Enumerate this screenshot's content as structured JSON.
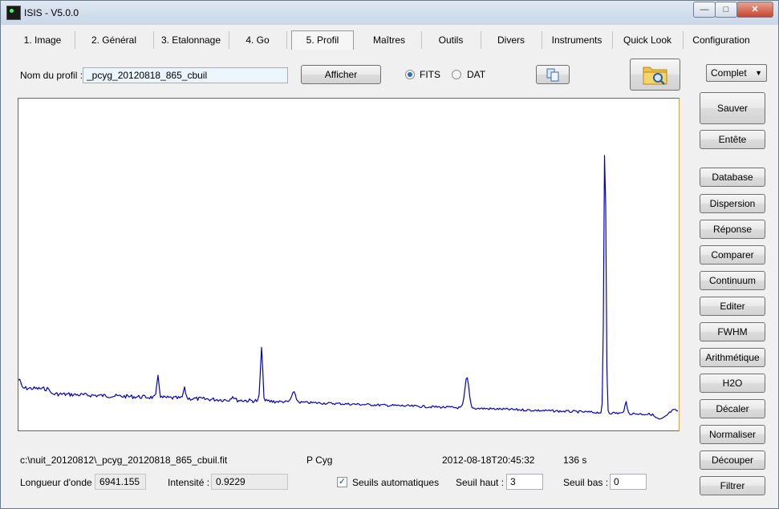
{
  "window": {
    "title": "ISIS - V5.0.0"
  },
  "controls": {
    "minimize": "—",
    "restore": "□",
    "close": "✕"
  },
  "tabs": [
    {
      "label": "1. Image"
    },
    {
      "label": "2. Général"
    },
    {
      "label": "3. Etalonnage"
    },
    {
      "label": "4. Go"
    },
    {
      "label": "5. Profil",
      "active": true
    },
    {
      "label": "Maîtres"
    },
    {
      "label": "Outils"
    },
    {
      "label": "Divers"
    },
    {
      "label": "Instruments"
    },
    {
      "label": "Quick Look"
    },
    {
      "label": "Configuration"
    }
  ],
  "profile": {
    "name_label": "Nom du profil :",
    "name_value": "_pcyg_20120818_865_cbuil",
    "show_button": "Afficher",
    "format_fits": "FITS",
    "format_dat": "DAT",
    "format_selected": "FITS"
  },
  "mode_select": {
    "value": "Complet"
  },
  "side_buttons": [
    "Sauver",
    "Entête",
    "Database",
    "Dispersion",
    "Réponse",
    "Comparer",
    "Continuum",
    "Editer",
    "FWHM",
    "Arithmétique",
    "H2O",
    "Décaler",
    "Normaliser",
    "Découper",
    "Filtrer"
  ],
  "status": {
    "file_path": "c:\\nuit_20120812\\_pcyg_20120818_865_cbuil.fit",
    "object": "P Cyg",
    "date": "2012-08-18T20:45:32",
    "exposure": "136 s",
    "wavelength_label": "Longueur d'onde :",
    "wavelength_value": "6941.155",
    "intensity_label": "Intensité :",
    "intensity_value": "0.9229",
    "auto_threshold_label": "Seuils automatiques",
    "auto_threshold_checked": true,
    "high_label": "Seuil haut :",
    "high_value": "3",
    "low_label": "Seuil bas :",
    "low_value": "0"
  },
  "colors": {
    "spectrum": "#0000c8",
    "plot_bg": "#ffffff"
  }
}
